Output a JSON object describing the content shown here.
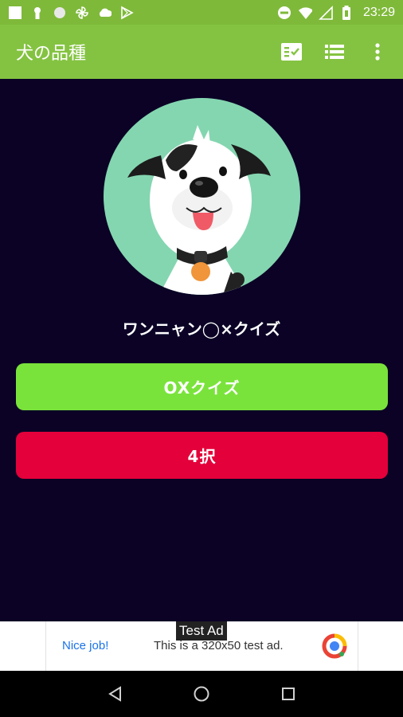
{
  "status_bar": {
    "time": "23:29",
    "icons": [
      "square-notification-icon",
      "keyhole-icon",
      "circle-icon",
      "pinwheel-icon",
      "cloud-icon",
      "play-store-icon",
      "do-not-disturb-icon",
      "wifi-icon",
      "signal-icon",
      "battery-icon"
    ]
  },
  "app_bar": {
    "title": "犬の品種",
    "actions": [
      "checklist-icon",
      "list-icon",
      "more-vert-icon"
    ],
    "background": "#84c341"
  },
  "main": {
    "background": "#0b0226",
    "logo": "dog-face-logo",
    "quiz_title": "ワンニャン◯×クイズ",
    "buttons": {
      "ox_label": "OXクイズ",
      "four_choice_label": "4択"
    },
    "colors": {
      "ox_button": "#7ae33b",
      "four_choice_button": "#e4003a"
    }
  },
  "ad": {
    "label": "Test Ad",
    "nice_job": "Nice job!",
    "text": "This is a 320x50 test ad.",
    "logo": "admob-logo"
  },
  "nav_bar": {
    "buttons": [
      "back-icon",
      "home-icon",
      "recents-icon"
    ]
  }
}
